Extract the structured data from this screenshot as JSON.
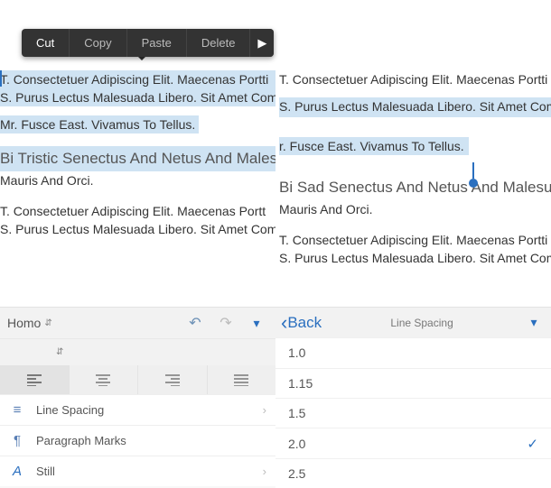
{
  "context_menu": {
    "cut": "Cut",
    "copy": "Copy",
    "paste": "Paste",
    "delete": "Delete"
  },
  "icons": {
    "play": "▶",
    "undo": "↶",
    "redo": "↷",
    "dropdown": "▾",
    "chevron_right": "›",
    "chevron_left": "‹",
    "check": "✓",
    "updown": "⇵",
    "paragraph": "¶",
    "text_a": "A",
    "line_spacing": "≡"
  },
  "doc": {
    "l1": "T. Consectetuer Adipiscing Elit. Maecenas Portti",
    "l2": "S. Purus Lectus Malesuada Libero. Sit Amet Comr",
    "l3": "Mr. Fusce East. Vivamus To Tellus.",
    "l4": "Bi Tristic Senectus And Netus And Malesuada Fam.",
    "l5": "Mauris And Orci.",
    "l6": "T. Consectetuer Adipiscing Elit. Maecenas Portt",
    "l7": "S. Purus Lectus Malesuada Libero. Sit Amet Comr",
    "r1": "T. Consectetuer Adipiscing Elit. Maecenas Portti",
    "r2": "S. Purus Lectus Malesuada Libero. Sit Amet Comr",
    "r3": "r. Fusce East. Vivamus To Tellus.",
    "r4": "Bi Sad Senectus And Netus And Malesuada Fant",
    "r5": "Mauris And Orci.",
    "r6": "T. Consectetuer Adipiscing Elit. Maecenas Portti",
    "r7": "S. Purus Lectus Malesuada Libero. Sit Amet Comr"
  },
  "left_panel": {
    "font_dropdown": "Homo",
    "line_spacing": "Line Spacing",
    "paragraph_marks": "Paragraph Marks",
    "still": "Still"
  },
  "right_panel": {
    "back": "Back",
    "title": "Line Spacing",
    "opts": {
      "o1": "1.0",
      "o2": "1.15",
      "o3": "1.5",
      "o4": "2.0",
      "o5": "2.5"
    },
    "selected": "2.0"
  }
}
